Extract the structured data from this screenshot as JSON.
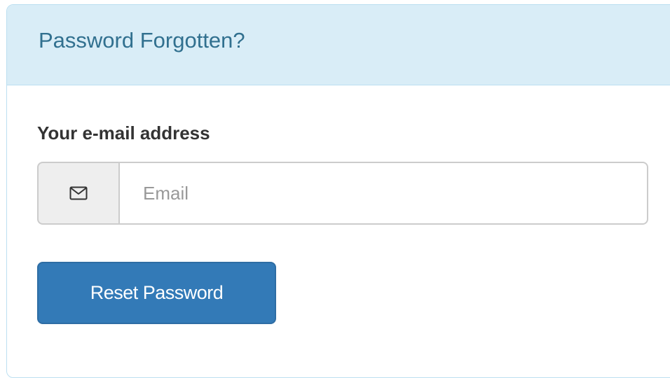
{
  "panel": {
    "title": "Password Forgotten?",
    "heading_bg": "#d9edf7",
    "heading_text_color": "#31708f"
  },
  "form": {
    "email_label": "Your e-mail address",
    "email_icon": "envelope-icon",
    "email_placeholder": "Email",
    "email_value": "",
    "submit_label": "Reset Password",
    "submit_color": "#337ab7"
  }
}
